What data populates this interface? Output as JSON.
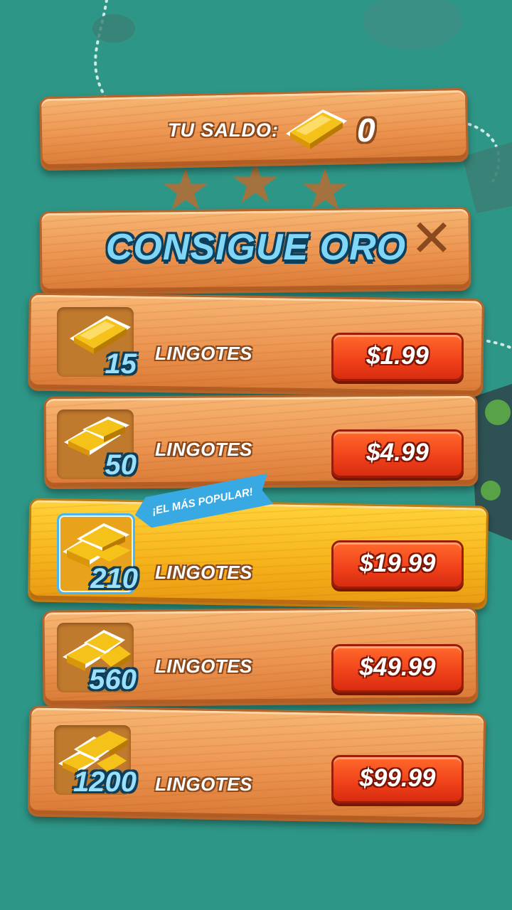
{
  "balance": {
    "label": "TU SALDO:",
    "value": "0",
    "icon": "gold-bar-icon"
  },
  "dialog": {
    "title": "CONSIGUE ORO",
    "close_icon": "close-icon"
  },
  "popular_badge": "¡EL MÁS POPULAR!",
  "offers": [
    {
      "amount": "15",
      "unit": "LINGOTES",
      "price": "$1.99",
      "icon": "gold-bar-icon",
      "highlighted": false
    },
    {
      "amount": "50",
      "unit": "LINGOTES",
      "price": "$4.99",
      "icon": "gold-bars-small-stack-icon",
      "highlighted": false
    },
    {
      "amount": "210",
      "unit": "LINGOTES",
      "price": "$19.99",
      "icon": "gold-bars-stack-icon",
      "highlighted": true
    },
    {
      "amount": "560",
      "unit": "LINGOTES",
      "price": "$49.99",
      "icon": "gold-bars-pile-icon",
      "highlighted": false
    },
    {
      "amount": "1200",
      "unit": "LINGOTES",
      "price": "$99.99",
      "icon": "gold-bars-large-pile-icon",
      "highlighted": false
    }
  ],
  "colors": {
    "background": "#2e9687",
    "wood": "#ec9450",
    "highlight_wood": "#f7b51c",
    "price_button": "#f0401a",
    "title_blue": "#7fd6f7",
    "ribbon": "#39a9e3"
  }
}
